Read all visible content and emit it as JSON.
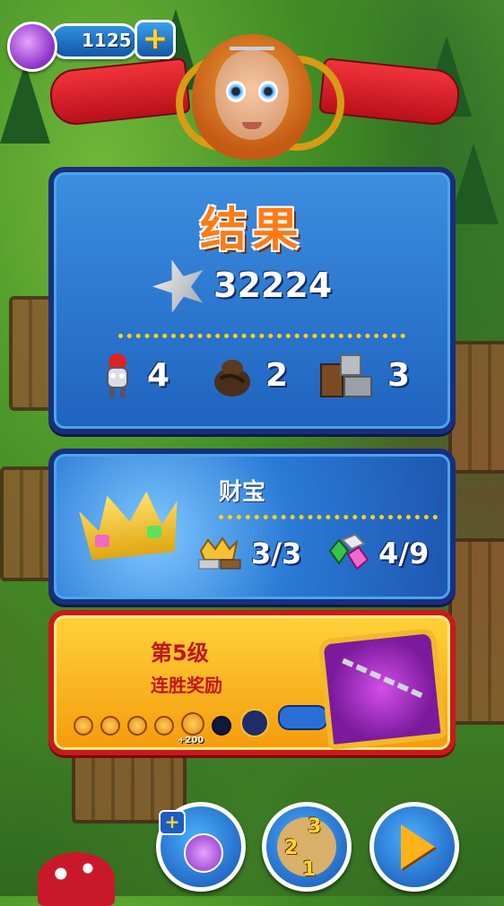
{
  "hud": {
    "potion_icon": "potion-bottle-icon",
    "gem_count": "1125",
    "add_button_label": "+"
  },
  "hero": {
    "portrait": "princess-portrait",
    "ribbon_color": "#d81f28"
  },
  "results": {
    "title": "结果",
    "score_icon": "silver-star-icon",
    "score": "32224",
    "stats": [
      {
        "icon": "knight-icon",
        "value": "4"
      },
      {
        "icon": "coal-sack-icon",
        "value": "2"
      },
      {
        "icon": "stone-block-icon",
        "value": "3"
      }
    ]
  },
  "treasure": {
    "title": "财宝",
    "icon": "golden-crown-icon",
    "items": [
      {
        "icon": "crowns-icon",
        "value": "3/3"
      },
      {
        "icon": "gems-icon",
        "value": "4/9"
      }
    ]
  },
  "reward": {
    "level": "第5级",
    "subtitle": "连胜奖励",
    "potion_bonus": "+200",
    "progress_filled": 5,
    "progress_total": 6,
    "chest_icon": "purple-chest-icon",
    "key_icon": "key-icon"
  },
  "buttons": {
    "potion_plus": "+",
    "map_numbers": [
      "3",
      "2",
      "1"
    ],
    "play_icon": "play-icon"
  },
  "colors": {
    "panel_blue": "#2670cc",
    "panel_border": "#1a2f7a",
    "reward_yellow": "#f8b520",
    "reward_border": "#c81a1a",
    "accent_gold": "#ffd11a"
  }
}
